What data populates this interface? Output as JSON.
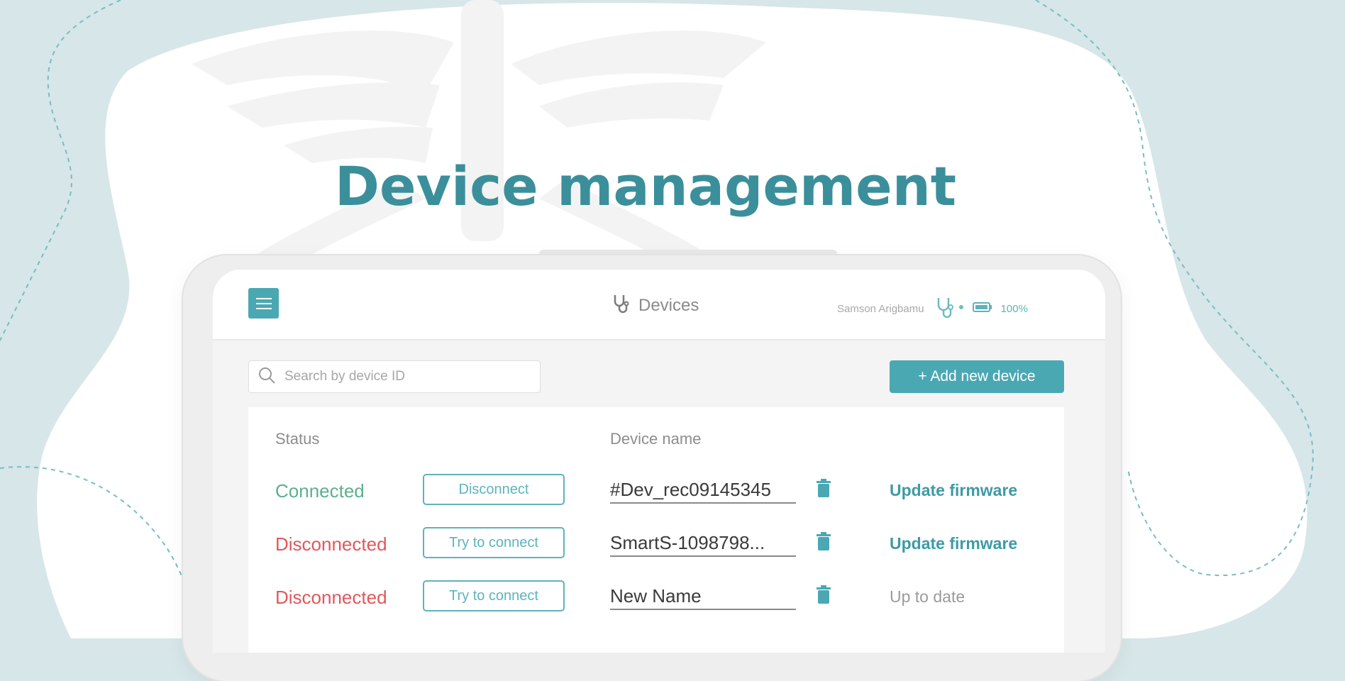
{
  "headline": "Device management",
  "colors": {
    "accent": "#4aa8b3",
    "connected": "#5cb08c",
    "disconnected": "#e0585d",
    "background": "#d7e6e8"
  },
  "appbar": {
    "menu_icon": "hamburger-menu-icon",
    "title": "Devices",
    "title_icon": "stethoscope-icon",
    "user_name": "Samson Arigbamu",
    "device_status_icon": "stethoscope-status-icon",
    "battery_icon": "battery-icon",
    "battery_level": "100%"
  },
  "toolbar": {
    "search_placeholder": "Search by device ID",
    "add_button_label": "+ Add new device"
  },
  "table": {
    "headers": {
      "status": "Status",
      "device_name": "Device name"
    },
    "rows": [
      {
        "status": "Connected",
        "action": "Disconnect",
        "name": "#Dev_rec09145345",
        "firmware": "Update firmware"
      },
      {
        "status": "Disconnected",
        "action": "Try to connect",
        "name": "SmartS-1098798...",
        "firmware": "Update firmware"
      },
      {
        "status": "Disconnected",
        "action": "Try to connect",
        "name": "New Name",
        "firmware": "Up to date"
      }
    ]
  }
}
